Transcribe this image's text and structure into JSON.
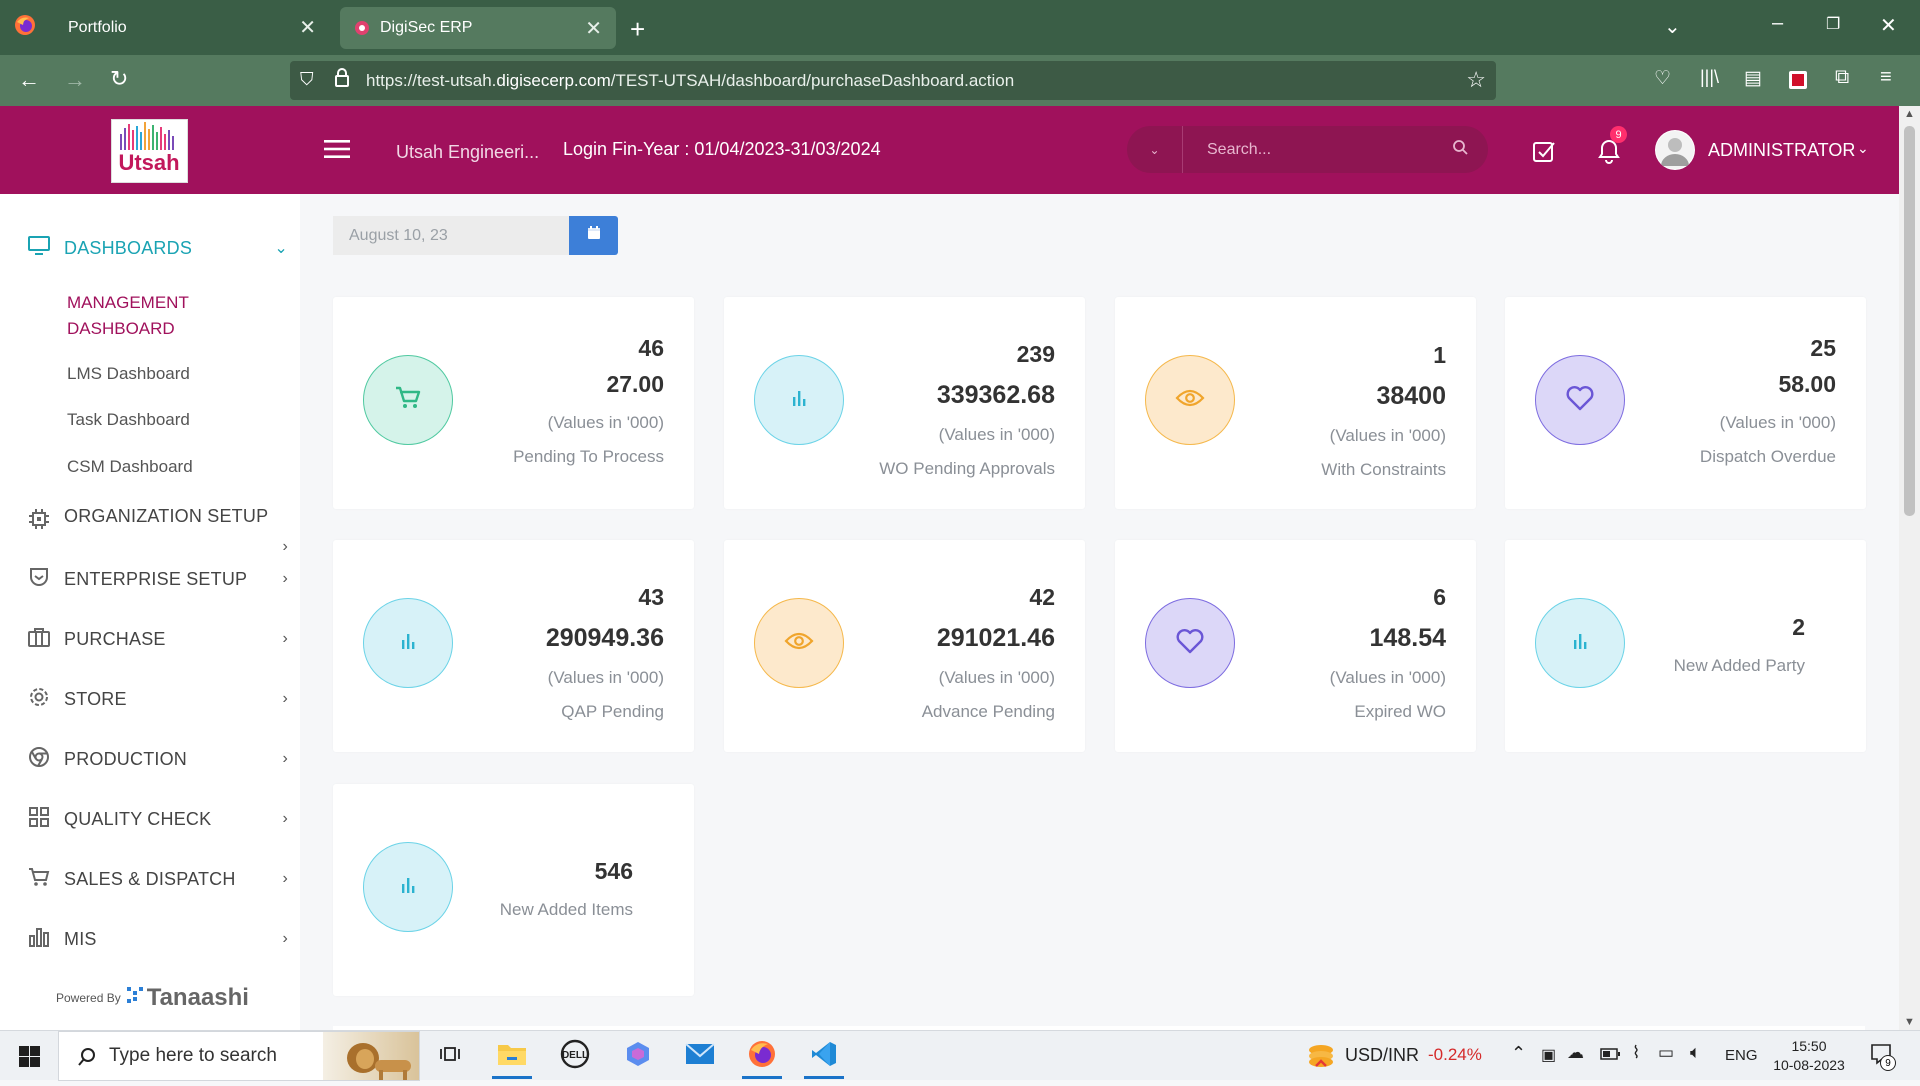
{
  "browser": {
    "tabs": [
      {
        "title": "Portfolio"
      },
      {
        "title": "DigiSec ERP"
      }
    ],
    "url_prefix": "https://test-utsah.",
    "url_domain": "digisecerp.com",
    "url_path": "/TEST-UTSAH/dashboard/purchaseDashboard.action"
  },
  "header": {
    "company": "Utsah Engineeri...",
    "fin_year": "Login Fin-Year : 01/04/2023-31/03/2024",
    "search_placeholder": "Search...",
    "notification_count": "9",
    "user": "ADMINISTRATOR",
    "logo_text": "Utsah"
  },
  "sidebar": {
    "items": [
      {
        "label": "DASHBOARDS",
        "icon": "monitor-icon"
      },
      {
        "label": "ORGANIZATION SETUP",
        "icon": "cpu-icon"
      },
      {
        "label": "ENTERPRISE SETUP",
        "icon": "shield-icon"
      },
      {
        "label": "PURCHASE",
        "icon": "briefcase-icon"
      },
      {
        "label": "STORE",
        "icon": "gear-icon"
      },
      {
        "label": "PRODUCTION",
        "icon": "chrome-icon"
      },
      {
        "label": "QUALITY CHECK",
        "icon": "grid-icon"
      },
      {
        "label": "SALES & DISPATCH",
        "icon": "cart-icon"
      },
      {
        "label": "MIS",
        "icon": "bar-chart-icon"
      }
    ],
    "sub_items": [
      {
        "label": "MANAGEMENT DASHBOARD"
      },
      {
        "label": "LMS Dashboard"
      },
      {
        "label": "Task Dashboard"
      },
      {
        "label": "CSM Dashboard"
      }
    ],
    "powered_by": "Powered By",
    "powered_brand": "Tanaashi"
  },
  "date_filter": {
    "value": "August 10, 23"
  },
  "values_note": "(Values in '000)",
  "cards": [
    {
      "count": "46",
      "amount": "27.00",
      "note": "(Values in '000)",
      "label": "Pending To Process",
      "icon": "cart-icon",
      "color": "#4fc9a0"
    },
    {
      "count": "239",
      "amount": "339362.68",
      "note": "(Values in '000)",
      "label": "WO Pending Approvals",
      "icon": "bar-chart-icon",
      "color": "#6bd3e7"
    },
    {
      "count": "1",
      "amount": "38400",
      "note": "(Values in '000)",
      "label": "With Constraints",
      "icon": "eye-icon",
      "color": "#f5b84b"
    },
    {
      "count": "25",
      "amount": "58.00",
      "note": "(Values in '000)",
      "label": "Dispatch Overdue",
      "icon": "heart-icon",
      "color": "#7d6ce0"
    },
    {
      "count": "43",
      "amount": "290949.36",
      "note": "(Values in '000)",
      "label": "QAP Pending",
      "icon": "bar-chart-icon",
      "color": "#6bd3e7"
    },
    {
      "count": "42",
      "amount": "291021.46",
      "note": "(Values in '000)",
      "label": "Advance Pending",
      "icon": "eye-icon",
      "color": "#f5b84b"
    },
    {
      "count": "6",
      "amount": "148.54",
      "note": "(Values in '000)",
      "label": "Expired WO",
      "icon": "heart-icon",
      "color": "#7d6ce0"
    },
    {
      "count": "2",
      "label": "New Added Party",
      "icon": "bar-chart-icon",
      "color": "#6bd3e7"
    },
    {
      "count": "546",
      "label": "New Added Items",
      "icon": "bar-chart-icon",
      "color": "#6bd3e7"
    }
  ],
  "taskbar": {
    "search_placeholder": "Type here to search",
    "fx_label": "USD/INR",
    "fx_change": "-0.24%",
    "lang": "ENG",
    "time": "15:50",
    "date": "10-08-2023",
    "notif_count": "9"
  },
  "colors": {
    "brand": "#a0115c",
    "accent": "#1aa3b3",
    "active_sub": "#a0115c"
  }
}
